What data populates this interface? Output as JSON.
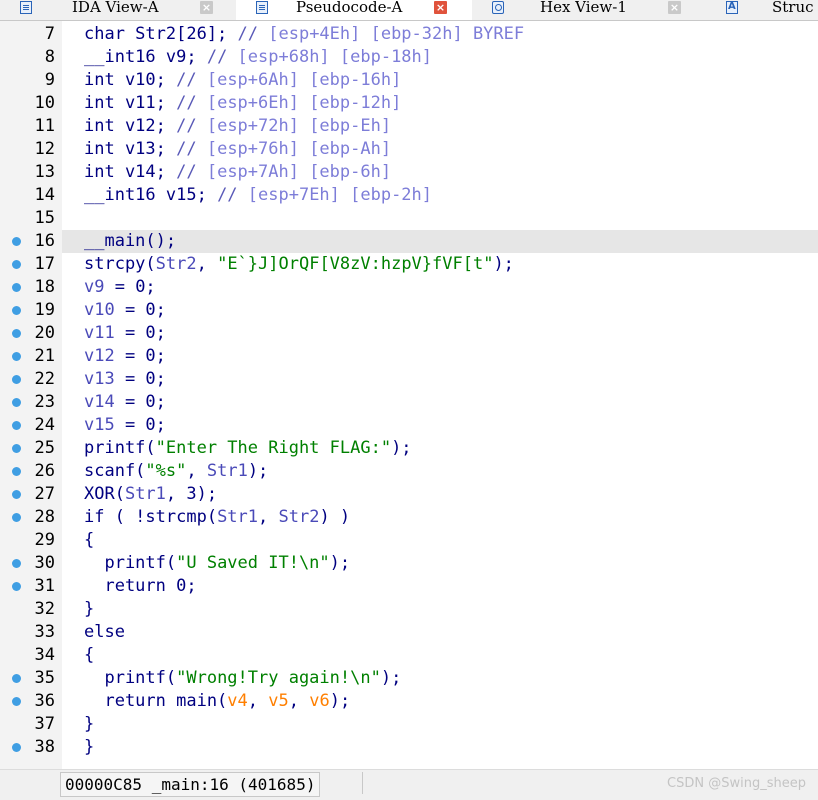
{
  "tabs": [
    {
      "label": "IDA View-A",
      "icon": "list-icon",
      "active": false
    },
    {
      "label": "Pseudocode-A",
      "icon": "list-icon",
      "active": true
    },
    {
      "label": "Hex View-1",
      "icon": "hex-icon",
      "active": false
    },
    {
      "label": "Struc",
      "icon": "struct-icon",
      "active": false
    }
  ],
  "close_glyph": "×",
  "lines": [
    {
      "num": "7",
      "dot": false,
      "hl": false,
      "code": "char Str2[26]; // [esp+4Eh] [ebp-32h] BYREF"
    },
    {
      "num": "8",
      "dot": false,
      "hl": false,
      "code": "__int16 v9; // [esp+68h] [ebp-18h]"
    },
    {
      "num": "9",
      "dot": false,
      "hl": false,
      "code": "int v10; // [esp+6Ah] [ebp-16h]"
    },
    {
      "num": "10",
      "dot": false,
      "hl": false,
      "code": "int v11; // [esp+6Eh] [ebp-12h]"
    },
    {
      "num": "11",
      "dot": false,
      "hl": false,
      "code": "int v12; // [esp+72h] [ebp-Eh]"
    },
    {
      "num": "12",
      "dot": false,
      "hl": false,
      "code": "int v13; // [esp+76h] [ebp-Ah]"
    },
    {
      "num": "13",
      "dot": false,
      "hl": false,
      "code": "int v14; // [esp+7Ah] [ebp-6h]"
    },
    {
      "num": "14",
      "dot": false,
      "hl": false,
      "code": "__int16 v15; // [esp+7Eh] [ebp-2h]"
    },
    {
      "num": "15",
      "dot": false,
      "hl": false,
      "code": ""
    },
    {
      "num": "16",
      "dot": true,
      "hl": true,
      "code": "__main();"
    },
    {
      "num": "17",
      "dot": true,
      "hl": false,
      "code": "strcpy(Str2, \"E`}J]OrQF[V8zV:hzpV}fVF[t\");"
    },
    {
      "num": "18",
      "dot": true,
      "hl": false,
      "code": "v9 = 0;"
    },
    {
      "num": "19",
      "dot": true,
      "hl": false,
      "code": "v10 = 0;"
    },
    {
      "num": "20",
      "dot": true,
      "hl": false,
      "code": "v11 = 0;"
    },
    {
      "num": "21",
      "dot": true,
      "hl": false,
      "code": "v12 = 0;"
    },
    {
      "num": "22",
      "dot": true,
      "hl": false,
      "code": "v13 = 0;"
    },
    {
      "num": "23",
      "dot": true,
      "hl": false,
      "code": "v14 = 0;"
    },
    {
      "num": "24",
      "dot": true,
      "hl": false,
      "code": "v15 = 0;"
    },
    {
      "num": "25",
      "dot": true,
      "hl": false,
      "code": "printf(\"Enter The Right FLAG:\");"
    },
    {
      "num": "26",
      "dot": true,
      "hl": false,
      "code": "scanf(\"%s\", Str1);"
    },
    {
      "num": "27",
      "dot": true,
      "hl": false,
      "code": "XOR(Str1, 3);"
    },
    {
      "num": "28",
      "dot": true,
      "hl": false,
      "code": "if ( !strcmp(Str1, Str2) )"
    },
    {
      "num": "29",
      "dot": false,
      "hl": false,
      "code": "{"
    },
    {
      "num": "30",
      "dot": true,
      "hl": false,
      "code": "  printf(\"U Saved IT!\\n\");"
    },
    {
      "num": "31",
      "dot": true,
      "hl": false,
      "code": "  return 0;"
    },
    {
      "num": "32",
      "dot": false,
      "hl": false,
      "code": "}"
    },
    {
      "num": "33",
      "dot": false,
      "hl": false,
      "code": "else"
    },
    {
      "num": "34",
      "dot": false,
      "hl": false,
      "code": "{"
    },
    {
      "num": "35",
      "dot": true,
      "hl": false,
      "code": "  printf(\"Wrong!Try again!\\n\");"
    },
    {
      "num": "36",
      "dot": true,
      "hl": false,
      "code": "  return main(v4, v5, v6);"
    },
    {
      "num": "37",
      "dot": false,
      "hl": false,
      "code": "}"
    },
    {
      "num": "38",
      "dot": true,
      "hl": false,
      "code": "}"
    }
  ],
  "status": {
    "location": "00000C85 _main:16 (401685)",
    "watermark": "CSDN @Swing_sheep"
  },
  "colors": {
    "comment": "#7d7dd8",
    "string": "#008000",
    "variable": "#4a4ab8",
    "argument": "#ff7f00",
    "code": "#000080",
    "breakpoint_dot": "#3f9ee3",
    "active_close": "#e0533c"
  }
}
